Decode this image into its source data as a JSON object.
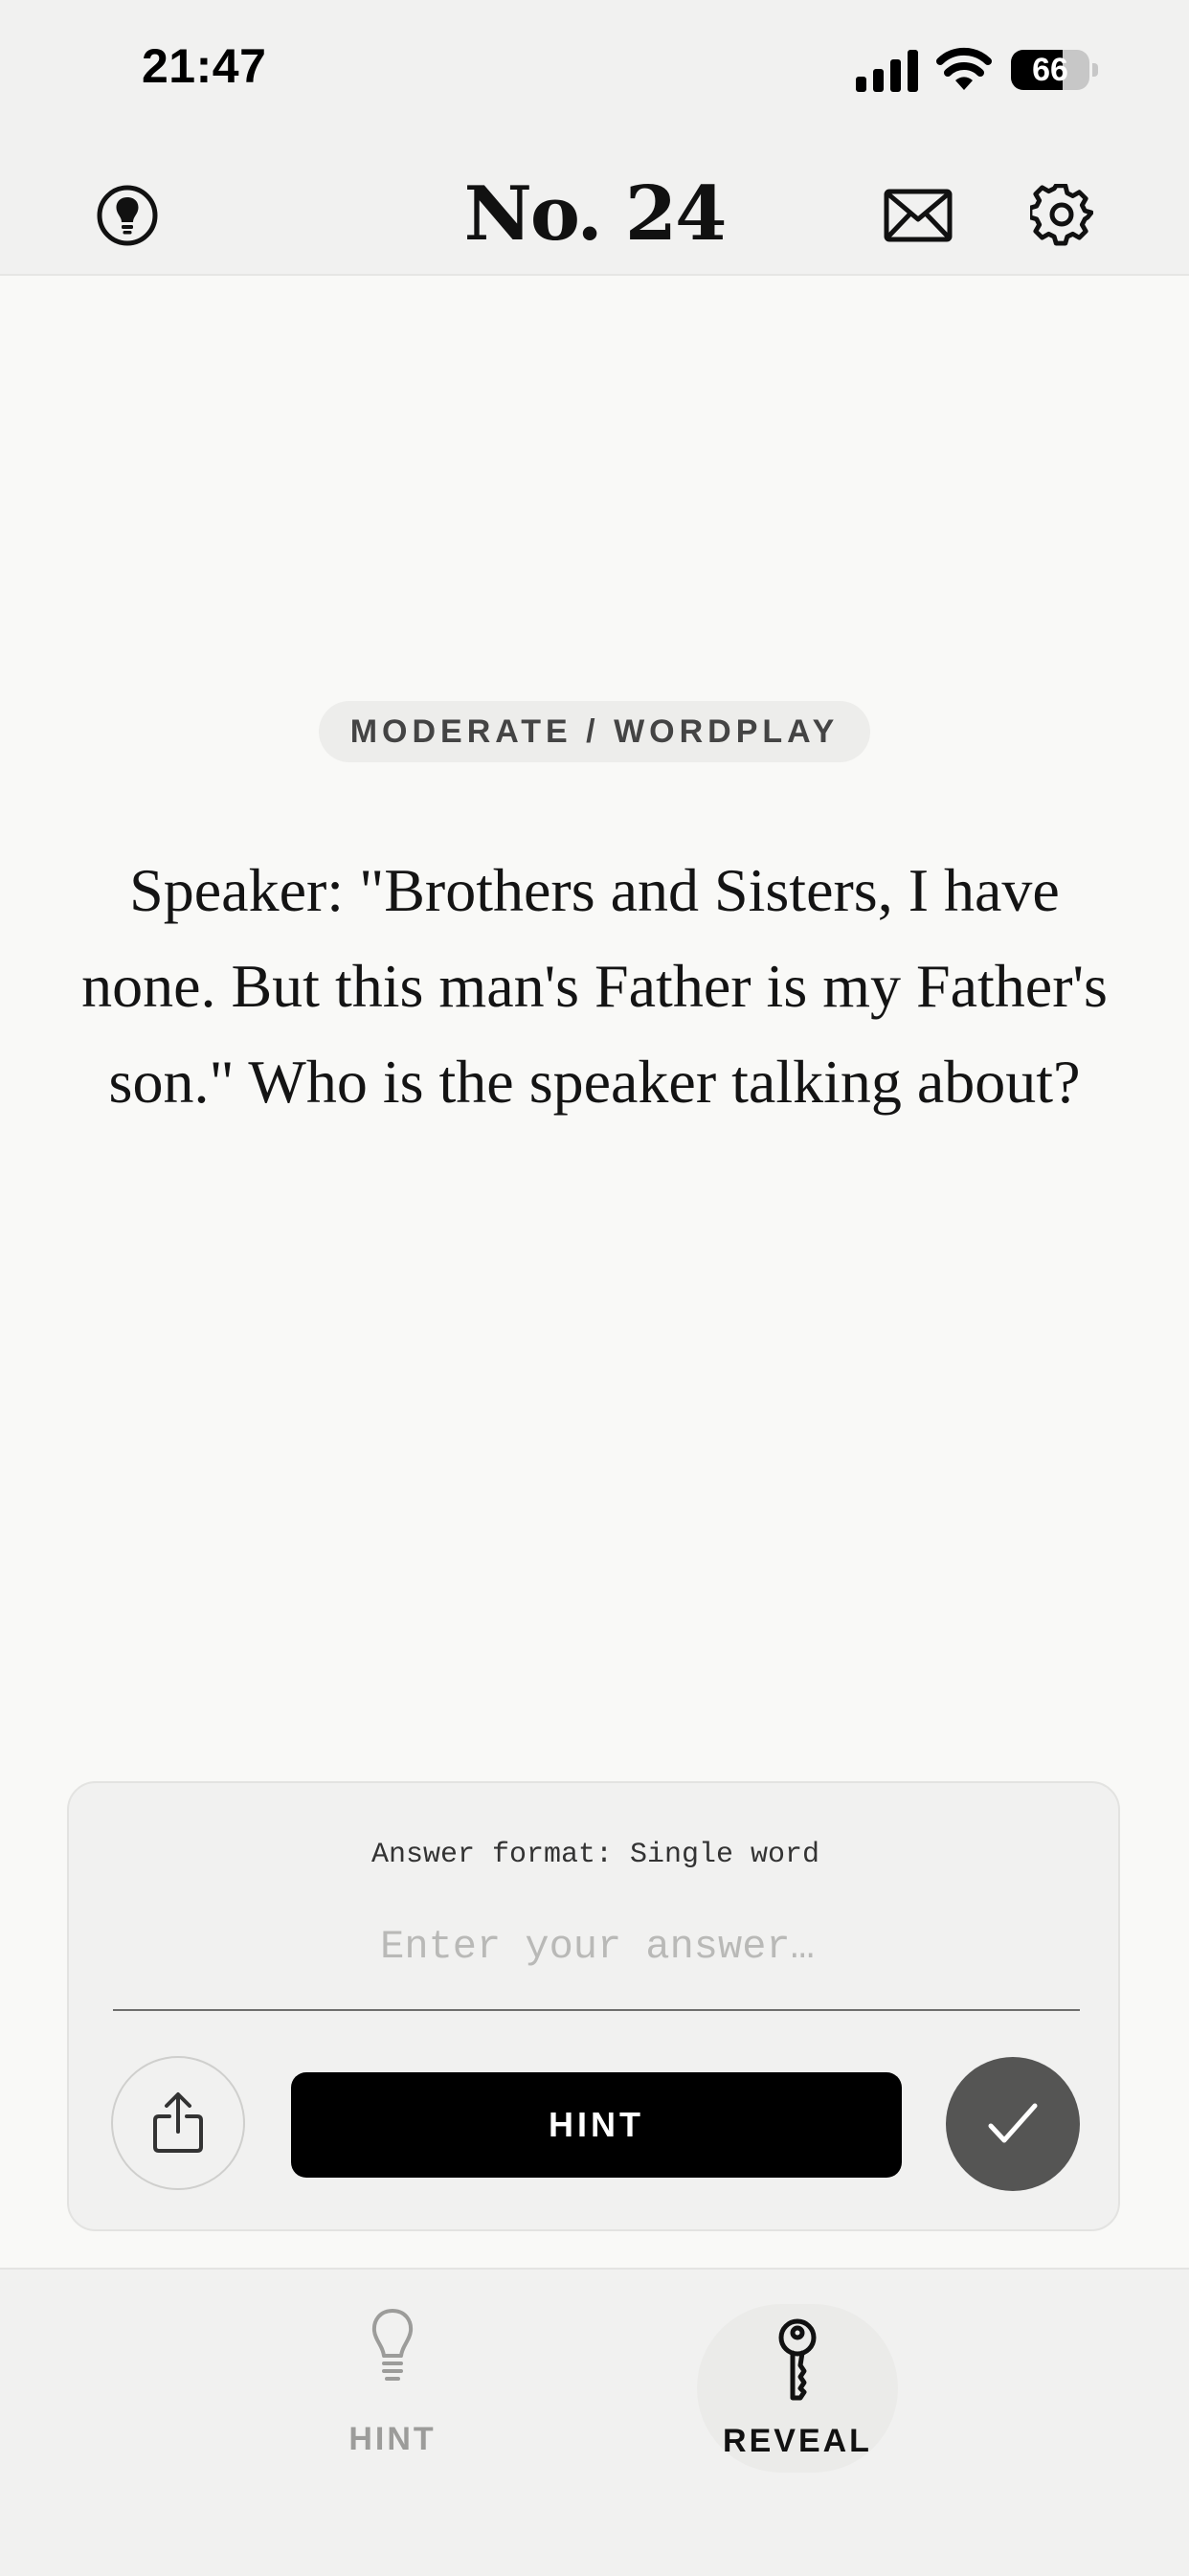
{
  "status_bar": {
    "time": "21:47",
    "battery_level": "66",
    "battery_fraction": 0.66
  },
  "header": {
    "title": "No. 24",
    "left_icon": "lightbulb-icon",
    "mail_icon": "mail-icon",
    "settings_icon": "gear-icon"
  },
  "puzzle": {
    "category": "MODERATE / WORDPLAY",
    "riddle": "Speaker: \"Brothers and Sisters, I have none. But this man's Father is my Father's son.\" Who is the speaker talking about?"
  },
  "answer": {
    "format_label": "Answer format: Single word",
    "placeholder": "Enter your answer…",
    "value": "",
    "share_icon": "share-icon",
    "hint_button_label": "HINT",
    "submit_icon": "checkmark-icon"
  },
  "tabs": [
    {
      "label": "HINT",
      "icon": "lightbulb-icon",
      "active": false
    },
    {
      "label": "REVEAL",
      "icon": "key-icon",
      "active": true
    }
  ],
  "colors": {
    "background": "#f9f9f7",
    "header_background": "#f1f1f0",
    "primary_button": "#000000",
    "submit_button": "#555554",
    "inactive_tab_text": "#9c9c9a"
  }
}
